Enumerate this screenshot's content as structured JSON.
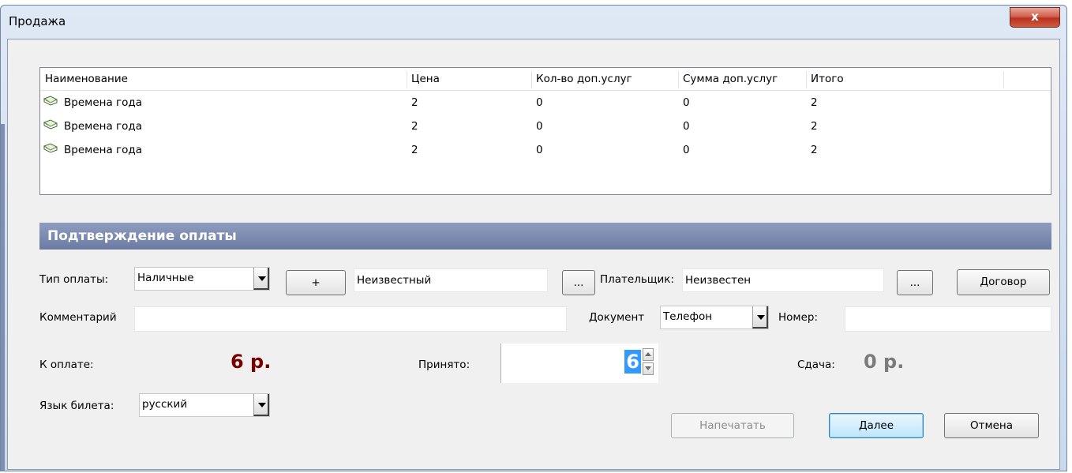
{
  "window": {
    "title": "Продажа",
    "close_label": "x"
  },
  "table": {
    "columns": [
      "Наименование",
      "Цена",
      "Кол-во доп.услуг",
      "Сумма доп.услуг",
      "Итого"
    ],
    "rows": [
      {
        "name": "Времена года",
        "price": "2",
        "extra_count": "0",
        "extra_sum": "0",
        "total": "2",
        "icon": "book-icon"
      },
      {
        "name": "Времена года",
        "price": "2",
        "extra_count": "0",
        "extra_sum": "0",
        "total": "2",
        "icon": "book-icon"
      },
      {
        "name": "Времена года",
        "price": "2",
        "extra_count": "0",
        "extra_sum": "0",
        "total": "2",
        "icon": "book-icon"
      }
    ]
  },
  "payment": {
    "section_title": "Подтверждение оплаты",
    "type_label": "Тип оплаты:",
    "type_value": "Наличные",
    "add_label": "+",
    "unknown_value": "Неизвестный",
    "browse_label": "...",
    "payer_label": "Плательщик:",
    "payer_value": "Неизвестен",
    "contract_label": "Договор",
    "comment_label": "Комментарий",
    "comment_value": "",
    "document_label": "Документ",
    "document_value": "Телефон",
    "number_label": "Номер:",
    "number_value": "",
    "due_label": "К оплате:",
    "due_value": "6 р.",
    "accepted_label": "Принято:",
    "accepted_value": "6",
    "change_label": "Сдача:",
    "change_value": "0 р.",
    "ticket_lang_label": "Язык билета:",
    "ticket_lang_value": "русский"
  },
  "buttons": {
    "print": "Напечатать",
    "next": "Далее",
    "cancel": "Отмена"
  }
}
